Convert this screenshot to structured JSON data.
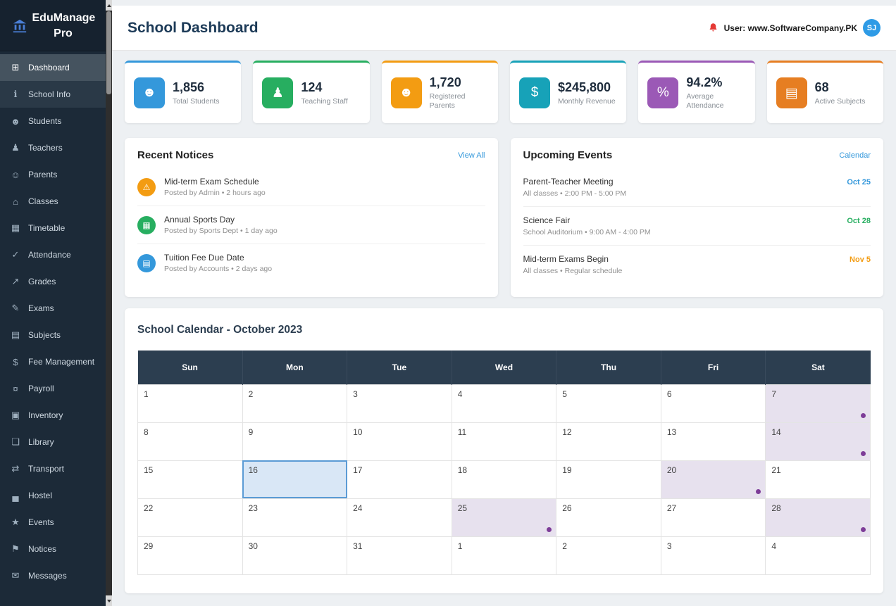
{
  "colors": {
    "sidebar_bg": "#1c2a38",
    "accent_blue": "#3498db",
    "accent_green": "#27ae60",
    "accent_orange": "#f39c12",
    "accent_teal": "#17a2b8",
    "accent_purple": "#9b59b6",
    "accent_dark_orange": "#e67e22",
    "calendar_header_bg": "#2c3e50",
    "event_day_bg": "#e7e1ee",
    "event_dot": "#7d3c98",
    "today_highlight": "#5b9bd5",
    "avatar_bg": "#2e9be6"
  },
  "app": {
    "title": "EduManage Pro"
  },
  "sidebar": {
    "items": [
      {
        "label": "Dashboard",
        "icon": "⊞"
      },
      {
        "label": "School Info",
        "icon": "ℹ"
      },
      {
        "label": "Students",
        "icon": "☻"
      },
      {
        "label": "Teachers",
        "icon": "♟"
      },
      {
        "label": "Parents",
        "icon": "☺"
      },
      {
        "label": "Classes",
        "icon": "⌂"
      },
      {
        "label": "Timetable",
        "icon": "▦"
      },
      {
        "label": "Attendance",
        "icon": "✓"
      },
      {
        "label": "Grades",
        "icon": "↗"
      },
      {
        "label": "Exams",
        "icon": "✎"
      },
      {
        "label": "Subjects",
        "icon": "▤"
      },
      {
        "label": "Fee Management",
        "icon": "$"
      },
      {
        "label": "Payroll",
        "icon": "¤"
      },
      {
        "label": "Inventory",
        "icon": "▣"
      },
      {
        "label": "Library",
        "icon": "❏"
      },
      {
        "label": "Transport",
        "icon": "⇄"
      },
      {
        "label": "Hostel",
        "icon": "▄"
      },
      {
        "label": "Events",
        "icon": "★"
      },
      {
        "label": "Notices",
        "icon": "⚑"
      },
      {
        "label": "Messages",
        "icon": "✉"
      }
    ]
  },
  "header": {
    "title": "School Dashboard",
    "user_label": "User: www.SoftwareCompany.PK",
    "avatar_initials": "SJ"
  },
  "stats": [
    {
      "value": "1,856",
      "label": "Total Students",
      "icon": "☻",
      "color": "#3498db"
    },
    {
      "value": "124",
      "label": "Teaching Staff",
      "icon": "♟",
      "color": "#27ae60"
    },
    {
      "value": "1,720",
      "label": "Registered Parents",
      "icon": "☻",
      "color": "#f39c12"
    },
    {
      "value": "$245,800",
      "label": "Monthly Revenue",
      "icon": "$",
      "color": "#17a2b8"
    },
    {
      "value": "94.2%",
      "label": "Average Attendance",
      "icon": "%",
      "color": "#9b59b6"
    },
    {
      "value": "68",
      "label": "Active Subjects",
      "icon": "▤",
      "color": "#e67e22"
    }
  ],
  "notices": {
    "title": "Recent Notices",
    "action": "View All",
    "items": [
      {
        "title": "Mid-term Exam Schedule",
        "meta": "Posted by Admin • 2 hours ago",
        "icon": "⚠",
        "color": "#f39c12"
      },
      {
        "title": "Annual Sports Day",
        "meta": "Posted by Sports Dept • 1 day ago",
        "icon": "▦",
        "color": "#27ae60"
      },
      {
        "title": "Tuition Fee Due Date",
        "meta": "Posted by Accounts • 2 days ago",
        "icon": "▤",
        "color": "#3498db"
      }
    ]
  },
  "events": {
    "title": "Upcoming Events",
    "action": "Calendar",
    "items": [
      {
        "title": "Parent-Teacher Meeting",
        "meta": "All classes • 2:00 PM - 5:00 PM",
        "date": "Oct 25",
        "color": "#3498db"
      },
      {
        "title": "Science Fair",
        "meta": "School Auditorium • 9:00 AM - 4:00 PM",
        "date": "Oct 28",
        "color": "#27ae60"
      },
      {
        "title": "Mid-term Exams Begin",
        "meta": "All classes • Regular schedule",
        "date": "Nov 5",
        "color": "#f39c12"
      }
    ]
  },
  "calendar": {
    "title": "School Calendar - October 2023",
    "day_headers": [
      "Sun",
      "Mon",
      "Tue",
      "Wed",
      "Thu",
      "Fri",
      "Sat"
    ],
    "cells": [
      {
        "day": "1",
        "state": "normal"
      },
      {
        "day": "2",
        "state": "normal"
      },
      {
        "day": "3",
        "state": "normal"
      },
      {
        "day": "4",
        "state": "normal"
      },
      {
        "day": "5",
        "state": "normal"
      },
      {
        "day": "6",
        "state": "normal"
      },
      {
        "day": "7",
        "state": "event"
      },
      {
        "day": "8",
        "state": "normal"
      },
      {
        "day": "9",
        "state": "normal"
      },
      {
        "day": "10",
        "state": "normal"
      },
      {
        "day": "11",
        "state": "normal"
      },
      {
        "day": "12",
        "state": "normal"
      },
      {
        "day": "13",
        "state": "normal"
      },
      {
        "day": "14",
        "state": "event"
      },
      {
        "day": "15",
        "state": "normal"
      },
      {
        "day": "16",
        "state": "today"
      },
      {
        "day": "17",
        "state": "normal"
      },
      {
        "day": "18",
        "state": "normal"
      },
      {
        "day": "19",
        "state": "normal"
      },
      {
        "day": "20",
        "state": "event"
      },
      {
        "day": "21",
        "state": "normal"
      },
      {
        "day": "22",
        "state": "normal"
      },
      {
        "day": "23",
        "state": "normal"
      },
      {
        "day": "24",
        "state": "normal"
      },
      {
        "day": "25",
        "state": "event"
      },
      {
        "day": "26",
        "state": "normal"
      },
      {
        "day": "27",
        "state": "normal"
      },
      {
        "day": "28",
        "state": "event"
      },
      {
        "day": "29",
        "state": "normal"
      },
      {
        "day": "30",
        "state": "normal"
      },
      {
        "day": "31",
        "state": "normal"
      },
      {
        "day": "1",
        "state": "next-month"
      },
      {
        "day": "2",
        "state": "next-month"
      },
      {
        "day": "3",
        "state": "next-month"
      },
      {
        "day": "4",
        "state": "next-month"
      }
    ]
  }
}
